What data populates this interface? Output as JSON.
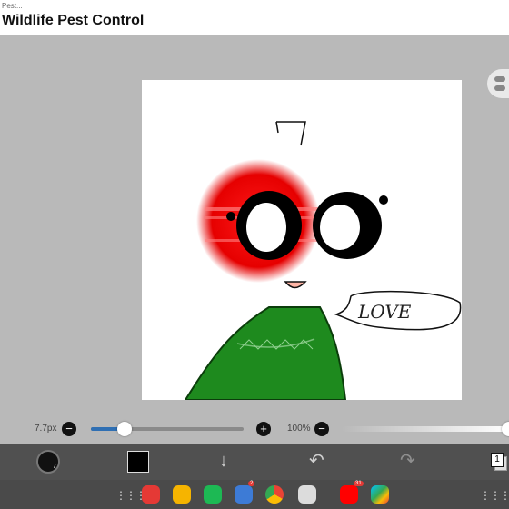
{
  "header": {
    "breadcrumb": "Pest...",
    "title": "Wildlife Pest Control"
  },
  "brush": {
    "size_label": "7.7px",
    "size_fraction": 0.22,
    "opacity_label": "100%",
    "opacity_fraction": 1.0,
    "size_value": "7"
  },
  "colors": {
    "current": "#000000",
    "accent": "#2f6fb3"
  },
  "drawing": {
    "speech_text": "LOVE"
  },
  "taskbar": {
    "badges": {
      "messages": "2",
      "youtube": "31"
    }
  }
}
